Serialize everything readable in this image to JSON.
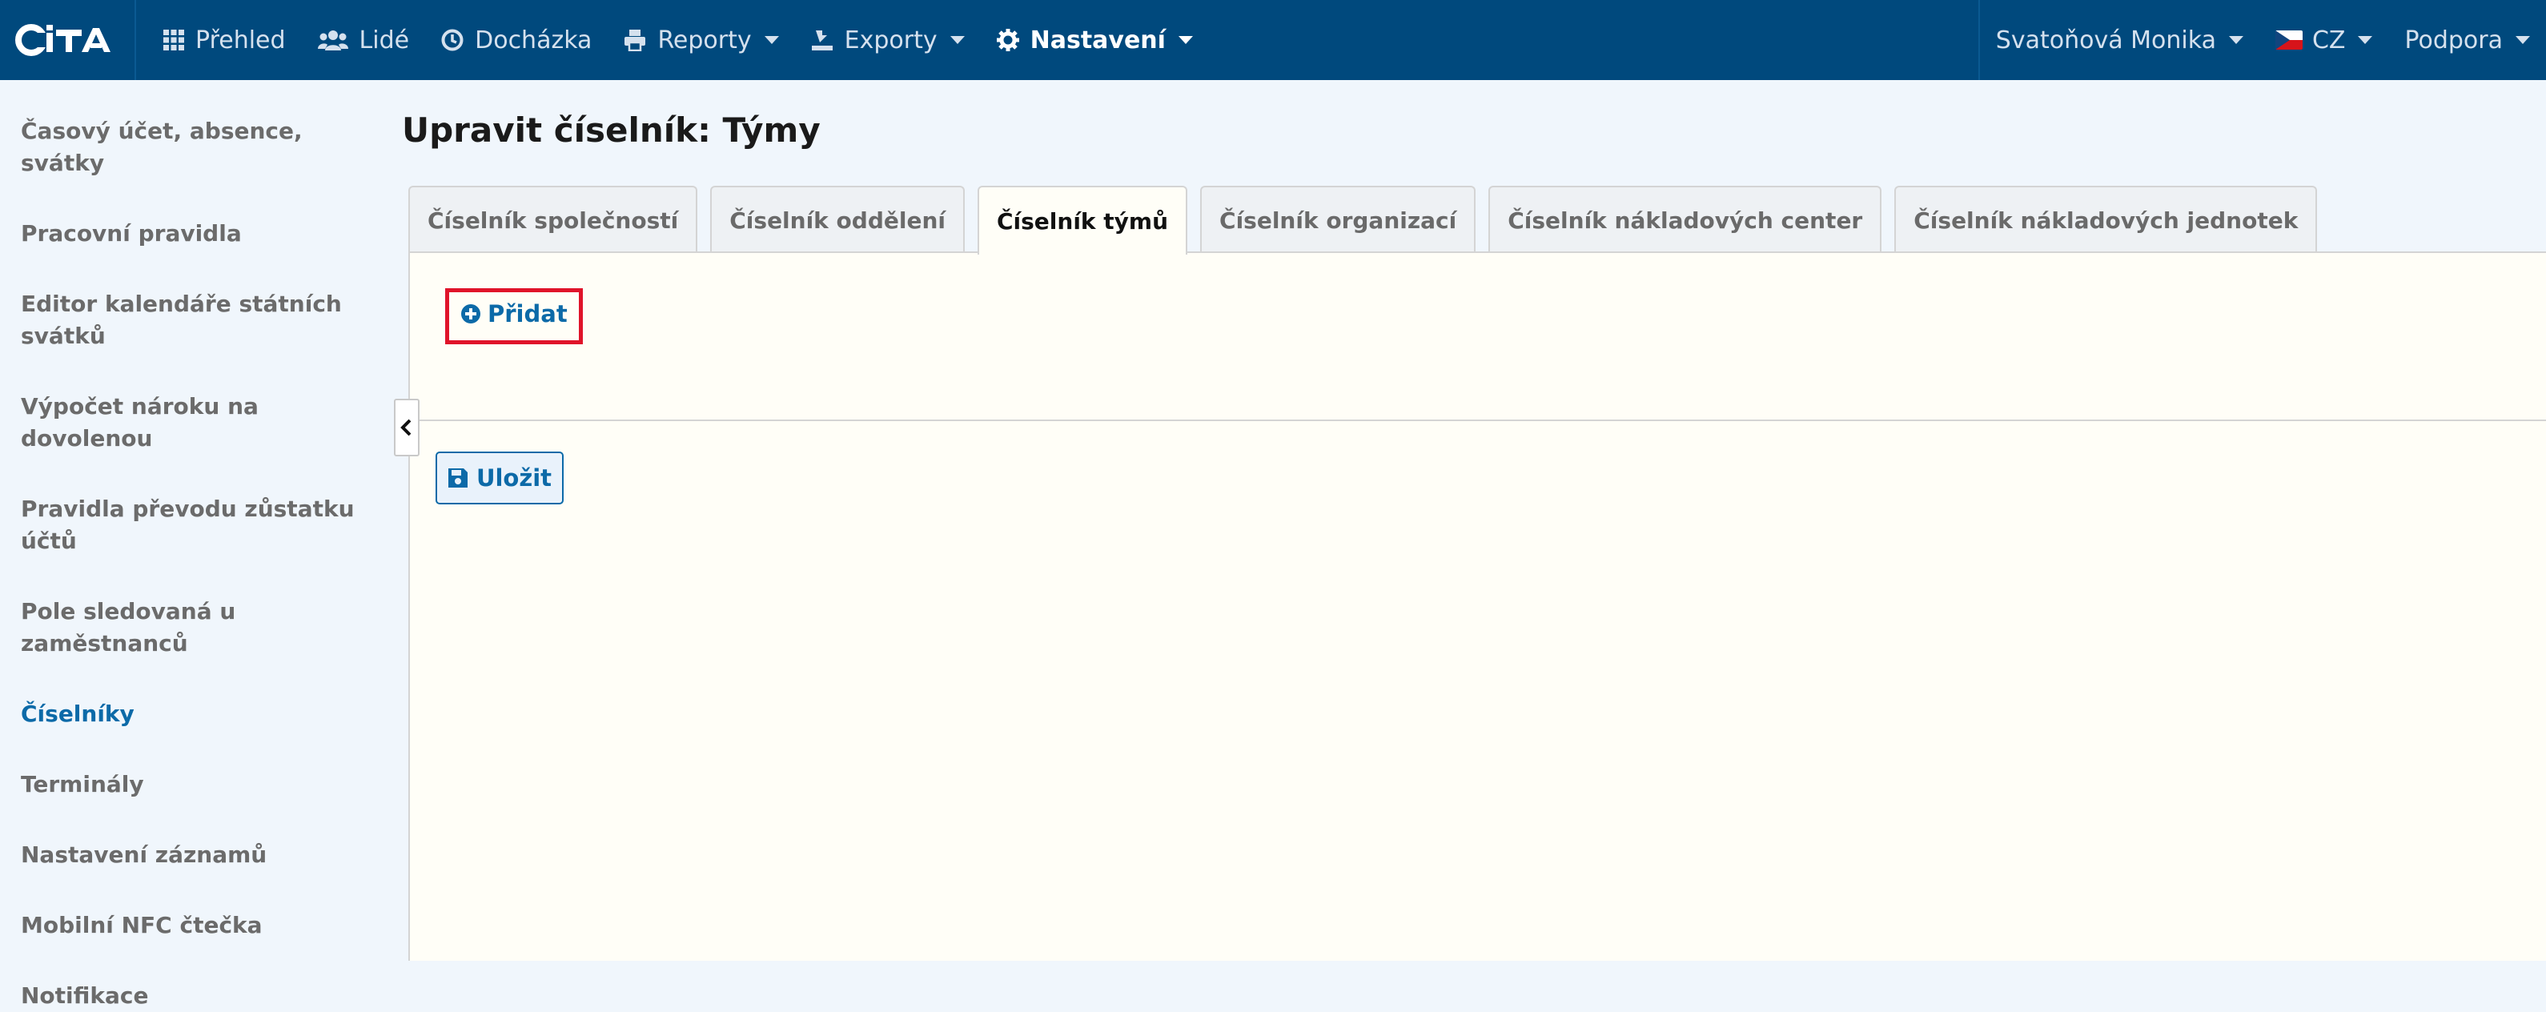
{
  "brand": {
    "logo_text": "CiTA"
  },
  "nav": {
    "items": [
      {
        "label": "Přehled",
        "icon": "grid-icon"
      },
      {
        "label": "Lidé",
        "icon": "users-icon"
      },
      {
        "label": "Docházka",
        "icon": "clock-icon"
      },
      {
        "label": "Reporty",
        "icon": "printer-icon"
      },
      {
        "label": "Exporty",
        "icon": "export-icon"
      },
      {
        "label": "Nastavení",
        "icon": "gear-icon"
      }
    ],
    "user": "Svatoňová Monika",
    "language": "CZ",
    "support": "Podpora"
  },
  "sidebar": {
    "items": [
      {
        "label": "Časový účet, absence, svátky"
      },
      {
        "label": "Pracovní pravidla"
      },
      {
        "label": "Editor kalendáře státních svátků"
      },
      {
        "label": "Výpočet nároku na dovolenou"
      },
      {
        "label": "Pravidla převodu zůstatku účtů"
      },
      {
        "label": "Pole sledovaná u zaměstnanců"
      },
      {
        "label": "Číselníky"
      },
      {
        "label": "Terminály"
      },
      {
        "label": "Nastavení záznamů"
      },
      {
        "label": "Mobilní NFC čtečka"
      },
      {
        "label": "Notifikace"
      }
    ]
  },
  "main": {
    "title": "Upravit číselník: Týmy",
    "tabs": [
      {
        "label": "Číselník společností"
      },
      {
        "label": "Číselník oddělení"
      },
      {
        "label": "Číselník týmů"
      },
      {
        "label": "Číselník organizací"
      },
      {
        "label": "Číselník nákladových center"
      },
      {
        "label": "Číselník nákladových jednotek"
      }
    ],
    "add_label": "Přidat",
    "save_label": "Uložit"
  },
  "colors": {
    "header_bg": "#00497d",
    "accent": "#0c6aa8",
    "highlight": "#e0142a",
    "page_bg": "#f0f6fc"
  }
}
